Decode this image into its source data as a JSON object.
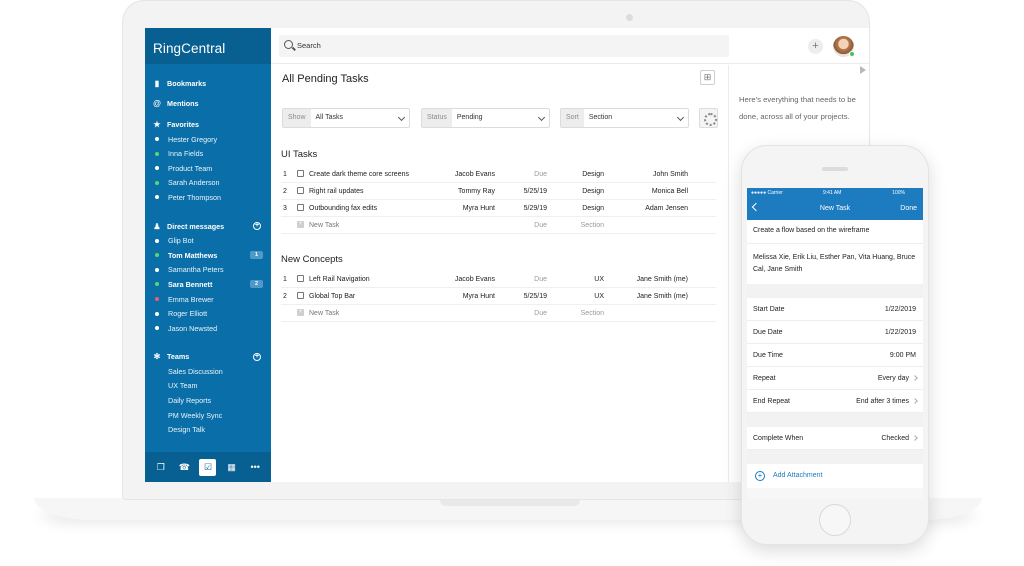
{
  "app": {
    "brand": "RingCentral"
  },
  "header": {
    "search_placeholder": "Search"
  },
  "sidebar": {
    "bookmarks": "Bookmarks",
    "mentions": "Mentions",
    "favorites_heading": "Favorites",
    "favorites": [
      {
        "name": "Hester Gregory",
        "status": "white"
      },
      {
        "name": "Inna Fields",
        "status": "green"
      },
      {
        "name": "Product Team",
        "status": "white"
      },
      {
        "name": "Sarah Anderson",
        "status": "green"
      },
      {
        "name": "Peter Thompson",
        "status": "white"
      }
    ],
    "dm_heading": "Direct messages",
    "dms": [
      {
        "name": "Glip Bot",
        "status": "white",
        "bold": false,
        "badge": ""
      },
      {
        "name": "Tom Matthews",
        "status": "green",
        "bold": true,
        "badge": "1"
      },
      {
        "name": "Samantha Peters",
        "status": "white",
        "bold": false,
        "badge": ""
      },
      {
        "name": "Sara Bennett",
        "status": "green",
        "bold": true,
        "badge": "2"
      },
      {
        "name": "Emma Brewer",
        "status": "red",
        "bold": false,
        "badge": ""
      },
      {
        "name": "Roger Elliott",
        "status": "white",
        "bold": false,
        "badge": ""
      },
      {
        "name": "Jason Newsted",
        "status": "white",
        "bold": false,
        "badge": ""
      }
    ],
    "teams_heading": "Teams",
    "teams": [
      "Sales Discussion",
      "UX Team",
      "Daily Reports",
      "PM Weekly Sync",
      "Design Talk"
    ]
  },
  "tasks": {
    "title": "All Pending Tasks",
    "filters": [
      {
        "label": "Show",
        "value": "All Tasks"
      },
      {
        "label": "Status",
        "value": "Pending"
      },
      {
        "label": "Sort",
        "value": "Section"
      }
    ],
    "new_task_label": "New Task",
    "new_task_due": "Due",
    "new_task_section": "Section",
    "groups": [
      {
        "title": "UI Tasks",
        "rows": [
          {
            "num": "1",
            "name": "Create dark theme core screens",
            "assignee": "Jacob Evans",
            "due": "Due",
            "section": "Design",
            "owner": "John Smith"
          },
          {
            "num": "2",
            "name": "Right rail updates",
            "assignee": "Tommy Ray",
            "due": "5/25/19",
            "section": "Design",
            "owner": "Monica Bell"
          },
          {
            "num": "3",
            "name": "Outbounding fax edits",
            "assignee": "Myra Hunt",
            "due": "5/29/19",
            "section": "Design",
            "owner": "Adam Jensen"
          }
        ]
      },
      {
        "title": "New Concepts",
        "rows": [
          {
            "num": "1",
            "name": "Left Rail Navigation",
            "assignee": "Jacob Evans",
            "due": "Due",
            "section": "UX",
            "owner": "Jane Smith (me)"
          },
          {
            "num": "2",
            "name": "Global Top Bar",
            "assignee": "Myra Hunt",
            "due": "5/25/19",
            "section": "UX",
            "owner": "Jane Smith (me)"
          }
        ]
      }
    ]
  },
  "right_panel": {
    "message": "Here's everything that needs to be done, across all of your projects."
  },
  "mobile": {
    "status": {
      "carrier": "●●●●● Carrier",
      "time": "9:41 AM",
      "battery": "100%"
    },
    "nav": {
      "title": "New Task",
      "done": "Done"
    },
    "description": "Create a flow based on the wireframe",
    "assignees": "Melissa Xie, Erik Liu, Esther Pan, Vita Huang, Bruce Cal, Jane Smith",
    "fields": [
      {
        "label": "Start Date",
        "value": "1/22/2019",
        "chevron": false
      },
      {
        "label": "Due Date",
        "value": "1/22/2019",
        "chevron": false
      },
      {
        "label": "Due Time",
        "value": "9:00 PM",
        "chevron": false
      },
      {
        "label": "Repeat",
        "value": "Every day",
        "chevron": true
      },
      {
        "label": "End Repeat",
        "value": "End after 3 times",
        "chevron": true
      }
    ],
    "complete_when": {
      "label": "Complete When",
      "value": "Checked"
    },
    "add_attachment": "Add Attachment"
  },
  "colors": {
    "sidebar": "#0a6fa8",
    "sidebar_dark": "#085f92",
    "mobile_accent": "#1d7bc0",
    "online": "#5bd66f",
    "busy": "#f05a6a"
  }
}
